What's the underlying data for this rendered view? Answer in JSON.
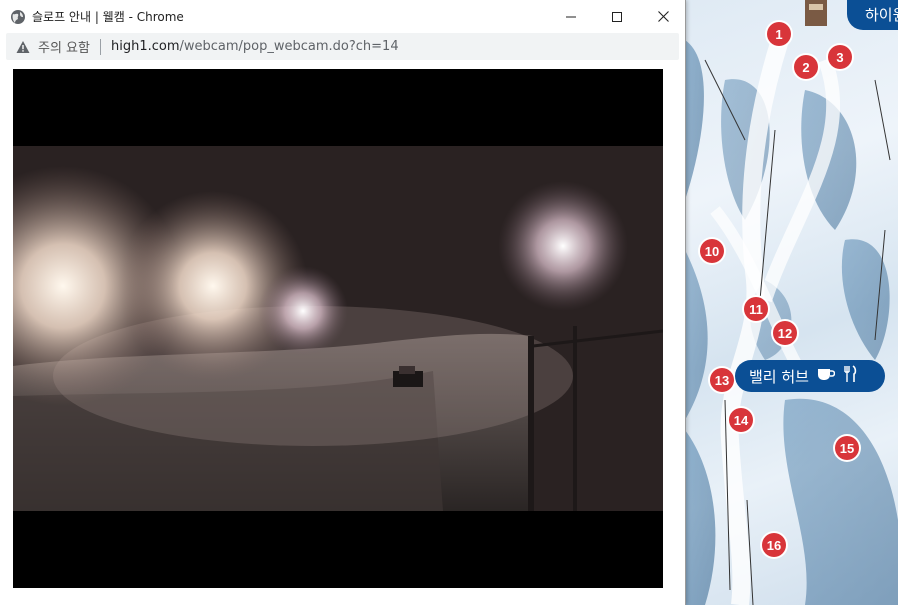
{
  "window": {
    "title": "슬로프 안내 | 웰캠 - Chrome",
    "controls": {
      "minimize": "minimize",
      "maximize": "maximize",
      "close": "close"
    }
  },
  "address": {
    "security_label": "주의 요함",
    "url_host": "high1.com",
    "url_path": "/webcam/pop_webcam.do?ch=14"
  },
  "map": {
    "pins": [
      "1",
      "2",
      "3",
      "10",
      "11",
      "12",
      "13",
      "14",
      "15",
      "16"
    ],
    "top_label": "하이원",
    "valley_label": "밸리 허브",
    "accent": "#0b4f95",
    "pin_color": "#d8353a"
  }
}
